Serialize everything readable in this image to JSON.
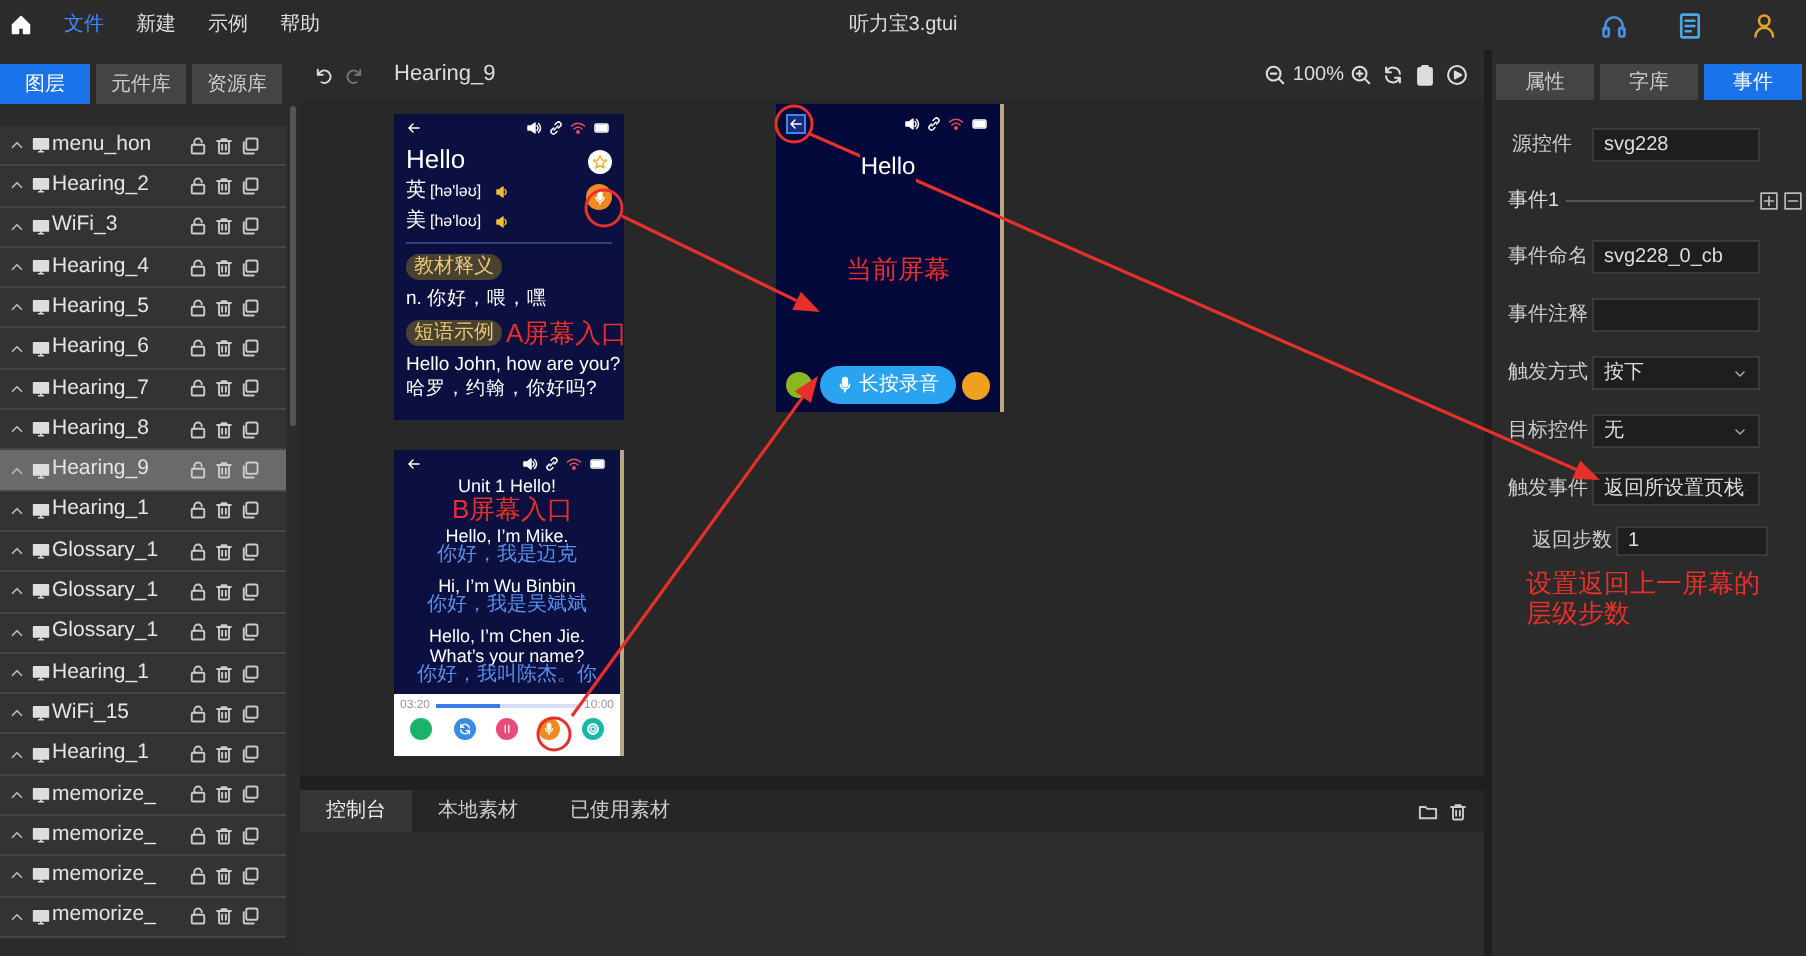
{
  "menu_bar": {
    "items": [
      {
        "label": "文件",
        "selected": true
      },
      {
        "label": "新建",
        "selected": false
      },
      {
        "label": "示例",
        "selected": false
      },
      {
        "label": "帮助",
        "selected": false
      }
    ],
    "title": "听力宝3.gtui"
  },
  "left_panel": {
    "tabs": [
      {
        "label": "图层",
        "selected": true
      },
      {
        "label": "元件库",
        "selected": false
      },
      {
        "label": "资源库",
        "selected": false
      }
    ],
    "layers": [
      {
        "name": "menu_hon",
        "selected": false
      },
      {
        "name": "Hearing_2",
        "selected": false
      },
      {
        "name": "WiFi_3",
        "selected": false
      },
      {
        "name": "Hearing_4",
        "selected": false
      },
      {
        "name": "Hearing_5",
        "selected": false
      },
      {
        "name": "Hearing_6",
        "selected": false
      },
      {
        "name": "Hearing_7",
        "selected": false
      },
      {
        "name": "Hearing_8",
        "selected": false
      },
      {
        "name": "Hearing_9",
        "selected": true
      },
      {
        "name": "Hearing_1",
        "selected": false
      },
      {
        "name": "Glossary_1",
        "selected": false
      },
      {
        "name": "Glossary_1",
        "selected": false
      },
      {
        "name": "Glossary_1",
        "selected": false
      },
      {
        "name": "Hearing_1",
        "selected": false
      },
      {
        "name": "WiFi_15",
        "selected": false
      },
      {
        "name": "Hearing_1",
        "selected": false
      },
      {
        "name": "memorize_",
        "selected": false
      },
      {
        "name": "memorize_",
        "selected": false
      },
      {
        "name": "memorize_",
        "selected": false
      },
      {
        "name": "memorize_",
        "selected": false
      }
    ]
  },
  "canvas": {
    "screen_name": "Hearing_9",
    "zoom": "100%",
    "screen_a": {
      "title": "Hello",
      "phonetics": [
        {
          "region": "英",
          "ipa": "[hə'ləʊ]"
        },
        {
          "region": "美",
          "ipa": "[hə'loʊ]"
        }
      ],
      "sections": [
        {
          "tag": "教材释义",
          "lines": [
            "n. 你好，喂，嘿"
          ]
        },
        {
          "tag": "短语示例",
          "lines": [
            "Hello John, how are you?",
            "哈罗，约翰，你好吗?"
          ]
        }
      ]
    },
    "screen_b": {
      "title": "Unit 1 Hello!",
      "lines": [
        {
          "text": "Hello, I’m Mike.",
          "kind": "english"
        },
        {
          "text": "你好，我是迈克",
          "kind": "chinese"
        },
        {
          "text": "Hi, I’m Wu Binbin",
          "kind": "english"
        },
        {
          "text": "你好，我是吴斌斌",
          "kind": "chinese"
        },
        {
          "text": "Hello, I’m Chen Jie.",
          "kind": "english"
        },
        {
          "text": "What’s your name?",
          "kind": "english"
        },
        {
          "text": "你好，我叫陈杰。你",
          "kind": "chinese"
        }
      ],
      "player": {
        "elapsed": "03:20",
        "total": "10:00",
        "level": 0.45
      }
    },
    "screen_c": {
      "title": "Hello",
      "record_button": "长按录音"
    }
  },
  "annotations": [
    {
      "text": "A屏幕入口"
    },
    {
      "text": "B屏幕入口"
    },
    {
      "text": "当前屏幕"
    },
    {
      "text": "设置返回上一屏幕的层级步数"
    }
  ],
  "bottom_panel": {
    "tabs": [
      {
        "label": "控制台",
        "selected": true
      },
      {
        "label": "本地素材",
        "selected": false
      },
      {
        "label": "已使用素材",
        "selected": false
      }
    ]
  },
  "right_panel": {
    "tabs": [
      {
        "label": "属性",
        "selected": false
      },
      {
        "label": "字库",
        "selected": false
      },
      {
        "label": "事件",
        "selected": true
      }
    ],
    "source": {
      "label": "源控件",
      "value": "svg228"
    },
    "event_title": "事件1",
    "fields": [
      {
        "label": "事件命名",
        "value": "svg228_0_cb",
        "kind": "input"
      },
      {
        "label": "事件注释",
        "kind": "input"
      },
      {
        "label": "触发方式",
        "value": "按下",
        "kind": "select"
      },
      {
        "label": "目标控件",
        "value": "无",
        "kind": "select"
      },
      {
        "label": "触发事件",
        "value": "返回所设置页栈",
        "kind": "select"
      },
      {
        "label": "返回步数",
        "value": "1",
        "kind": "step"
      }
    ]
  }
}
